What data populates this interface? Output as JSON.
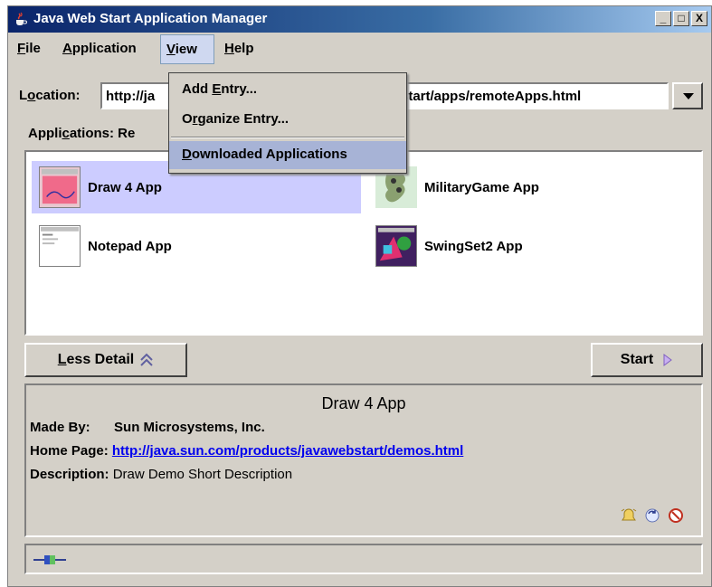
{
  "window": {
    "title": "Java Web Start Application Manager",
    "buttons": [
      "_",
      "□",
      "X"
    ]
  },
  "menubar": {
    "file": {
      "mnemonic": "F",
      "rest": "ile"
    },
    "application": {
      "mnemonic": "A",
      "rest": "pplication"
    },
    "view": {
      "mnemonic": "V",
      "rest": "iew"
    },
    "help": {
      "mnemonic": "H",
      "rest": "elp"
    }
  },
  "view_menu": {
    "items": [
      {
        "pre": "Add ",
        "mnemonic": "E",
        "post": "ntry..."
      },
      {
        "pre": "O",
        "mnemonic": "r",
        "post": "ganize Entry..."
      },
      {
        "pre": "",
        "mnemonic": "D",
        "post": "ownloaded Applications"
      }
    ]
  },
  "location": {
    "label_pre": "L",
    "label_mnemonic": "o",
    "label_post": "cation:",
    "value_visible_prefix": "http://ja",
    "value_visible_suffix": "start/apps/remoteApps.html"
  },
  "applications_label": {
    "pre": "Appli",
    "mnemonic": "c",
    "post": "ations:  Re"
  },
  "apps": [
    {
      "name": "Draw 4 App",
      "selected": true,
      "icon": "draw-app-icon"
    },
    {
      "name": "MilitaryGame App",
      "selected": false,
      "icon": "military-game-icon"
    },
    {
      "name": "Notepad App",
      "selected": false,
      "icon": "notepad-app-icon"
    },
    {
      "name": "SwingSet2 App",
      "selected": false,
      "icon": "swingset2-app-icon"
    }
  ],
  "buttons": {
    "less_detail": {
      "mnemonic": "L",
      "rest": "ess Detail"
    },
    "start": "Start"
  },
  "details": {
    "title": "Draw 4 App",
    "made_by_label": "Made By:",
    "made_by": "Sun Microsystems, Inc.",
    "home_page_label": "Home Page:",
    "home_page": "http://java.sun.com/products/javawebstart/demos.html",
    "description_label": "Description:",
    "description": "Draw Demo Short Description"
  },
  "colors": {
    "selection": "#ccccff",
    "menu_highlight": "#a7b3d6",
    "link": "#0000ee"
  }
}
